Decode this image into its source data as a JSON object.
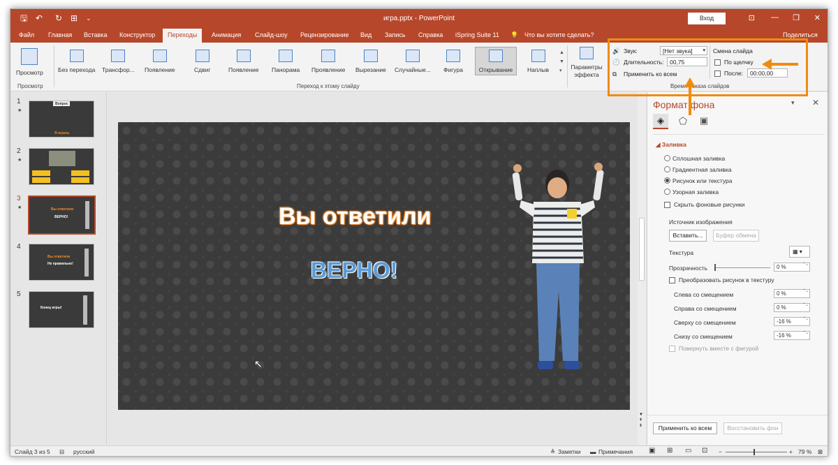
{
  "window": {
    "title": "игра.pptx - PowerPoint",
    "login": "Вход"
  },
  "tabs": [
    "Файл",
    "Главная",
    "Вставка",
    "Конструктор",
    "Переходы",
    "Анимация",
    "Слайд-шоу",
    "Рецензирование",
    "Вид",
    "Запись",
    "Справка",
    "iSpring Suite 11"
  ],
  "active_tab": "Переходы",
  "tell_me": "Что вы хотите сделать?",
  "share": "Поделиться",
  "ribbon": {
    "preview": {
      "label": "Просмотр",
      "group": "Просмотр"
    },
    "transitions": [
      "Без перехода",
      "Трансфор...",
      "Появление",
      "Сдвиг",
      "Появление",
      "Панорама",
      "Проявление",
      "Вырезание",
      "Случайные...",
      "Фигура",
      "Открывание",
      "Наплыв"
    ],
    "selected_transition": "Открывание",
    "transitions_group": "Переход к этому слайду",
    "effect_options": "Параметры эффекта",
    "timing": {
      "sound_label": "Звук:",
      "sound_value": "[Нет звука]",
      "duration_label": "Длительность:",
      "duration_value": "00,75",
      "apply_all": "Применить ко всем",
      "advance_title": "Смена слайда",
      "on_click": "По щелчку",
      "after": "После:",
      "after_value": "00:00,00",
      "group": "Время показа слайдов"
    }
  },
  "thumbnails": [
    {
      "num": "1",
      "star": "★",
      "text_a": "Вопрос",
      "text_b": "Я играть"
    },
    {
      "num": "2",
      "star": "★",
      "text_a": "",
      "text_b": ""
    },
    {
      "num": "3",
      "star": "★",
      "text_a": "Вы ответили",
      "text_b": "ВЕРНО!"
    },
    {
      "num": "4",
      "star": "",
      "text_a": "Вы ответили",
      "text_b": "Не правильно!"
    },
    {
      "num": "5",
      "star": "",
      "text_a": "Конец игры!",
      "text_b": ""
    }
  ],
  "selected_slide": "3",
  "slide": {
    "title": "Вы ответили",
    "answer": "ВЕРНО!"
  },
  "format_pane": {
    "title": "Формат фона",
    "section": "Заливка",
    "fill_options": [
      "Сплошная заливка",
      "Градиентная заливка",
      "Рисунок или текстура",
      "Узорная заливка"
    ],
    "selected_fill": "Рисунок или текстура",
    "hide_bg": "Скрыть фоновые рисунки",
    "source_label": "Источник изображения",
    "insert_btn": "Вставить...",
    "clipboard_btn": "Буфер обмена",
    "texture_label": "Текстура",
    "transparency_label": "Прозрачность",
    "transparency_value": "0 %",
    "tile_label": "Преобразовать рисунок в текстуру",
    "offsets": [
      {
        "label": "Слева со смещением",
        "value": "0 %"
      },
      {
        "label": "Справа со смещением",
        "value": "0 %"
      },
      {
        "label": "Сверху со смещением",
        "value": "-16 %"
      },
      {
        "label": "Снизу со смещением",
        "value": "-16 %"
      }
    ],
    "rotate_label": "Повернуть вместе с фигурой",
    "apply_all_btn": "Применить ко всем",
    "reset_btn": "Восстановить фон"
  },
  "status": {
    "slide_info": "Слайд 3 из 5",
    "language": "русский",
    "notes": "Заметки",
    "comments": "Примечания",
    "zoom": "79 %"
  },
  "colors": {
    "brand": "#b7472a",
    "highlight": "#f08b0f",
    "title_glow": "#f28a2e",
    "answer": "#5b9bd5"
  }
}
